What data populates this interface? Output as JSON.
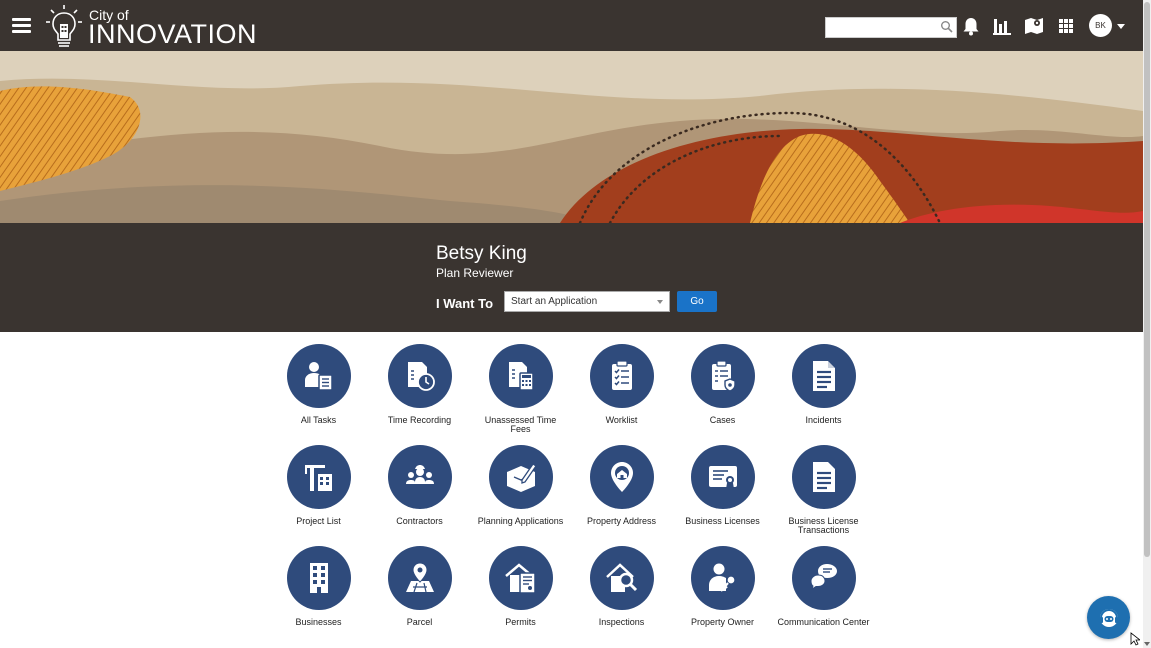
{
  "header": {
    "logo_small": "City of",
    "logo_big": "INNOVATION",
    "search_placeholder": "",
    "avatar_initials": "BK"
  },
  "profile": {
    "name": "Betsy King",
    "role": "Plan Reviewer",
    "i_want_label": "I Want To",
    "i_want_selected": "Start an Application",
    "go_label": "Go"
  },
  "tiles": [
    {
      "label": "All Tasks",
      "icon": "person-document-icon"
    },
    {
      "label": "Time Recording",
      "icon": "time-recording-icon"
    },
    {
      "label": "Unassessed Time Fees",
      "icon": "calculator-document-icon"
    },
    {
      "label": "Worklist",
      "icon": "clipboard-checklist-icon"
    },
    {
      "label": "Cases",
      "icon": "clipboard-badge-icon"
    },
    {
      "label": "Incidents",
      "icon": "document-icon"
    },
    {
      "label": "Project List",
      "icon": "crane-building-icon"
    },
    {
      "label": "Contractors",
      "icon": "workers-group-icon"
    },
    {
      "label": "Planning Applications",
      "icon": "blueprint-pencil-icon"
    },
    {
      "label": "Property Address",
      "icon": "home-location-pin-icon"
    },
    {
      "label": "Business Licenses",
      "icon": "certificate-icon"
    },
    {
      "label": "Business License Transactions",
      "icon": "document-lines-icon"
    },
    {
      "label": "Businesses",
      "icon": "office-building-icon"
    },
    {
      "label": "Parcel",
      "icon": "map-pin-parcel-icon"
    },
    {
      "label": "Permits",
      "icon": "house-permit-icon"
    },
    {
      "label": "Inspections",
      "icon": "house-magnifier-icon"
    },
    {
      "label": "Property Owner",
      "icon": "person-key-icon"
    },
    {
      "label": "Communication Center",
      "icon": "chat-bubbles-icon"
    }
  ],
  "colors": {
    "header_bg": "#3a3430",
    "tile_circle": "#2f4b7c",
    "go_button": "#1a73c8",
    "chat_button": "#1e6fb0"
  }
}
